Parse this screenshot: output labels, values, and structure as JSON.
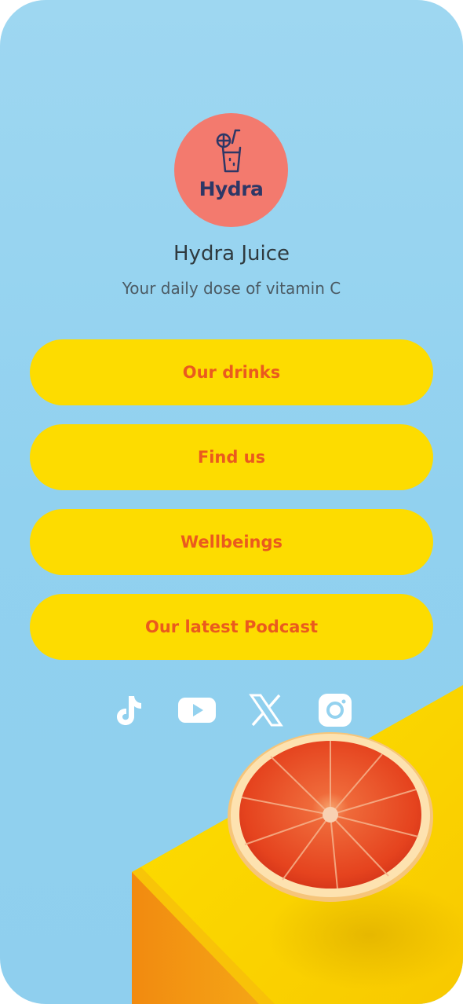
{
  "profile": {
    "logo_text": "Hydra",
    "name": "Hydra Juice",
    "tagline": "Your daily dose of vitamin C"
  },
  "links": [
    {
      "label": "Our drinks"
    },
    {
      "label": "Find us"
    },
    {
      "label": "Wellbeings"
    },
    {
      "label": "Our latest Podcast"
    }
  ],
  "social": [
    {
      "icon": "tiktok-icon"
    },
    {
      "icon": "youtube-icon"
    },
    {
      "icon": "x-icon"
    },
    {
      "icon": "instagram-icon"
    }
  ],
  "colors": {
    "background": "#9ed7f1",
    "button": "#fddc00",
    "button_text": "#ea5a1e",
    "logo_circle": "#f37a6e",
    "logo_ink": "#2d3766"
  }
}
